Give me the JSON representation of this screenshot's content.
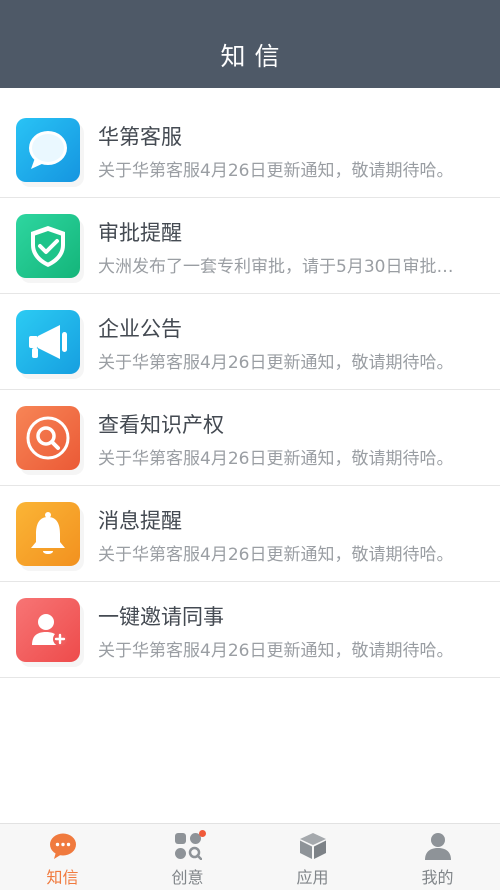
{
  "header": {
    "title": "知信"
  },
  "messages": [
    {
      "title": "华第客服",
      "subtitle": "关于华第客服4月26日更新通知，敬请期待哈。",
      "icon": "chat-bubble-icon",
      "color": "#1aa6e8"
    },
    {
      "title": "审批提醒",
      "subtitle": "大洲发布了一套专利审批，请于5月30日审批…",
      "icon": "shield-check-icon",
      "color": "#22c48a"
    },
    {
      "title": "企业公告",
      "subtitle": "关于华第客服4月26日更新通知，敬请期待哈。",
      "icon": "megaphone-icon",
      "color": "#22b3e6"
    },
    {
      "title": "查看知识产权",
      "subtitle": "关于华第客服4月26日更新通知，敬请期待哈。",
      "icon": "search-icon",
      "color": "#f06c42"
    },
    {
      "title": "消息提醒",
      "subtitle": "关于华第客服4月26日更新通知，敬请期待哈。",
      "icon": "bell-icon",
      "color": "#f5a026"
    },
    {
      "title": "一键邀请同事",
      "subtitle": "关于华第客服4月26日更新通知，敬请期待哈。",
      "icon": "add-user-icon",
      "color": "#f45f5f"
    }
  ],
  "tabs": [
    {
      "label": "知信",
      "icon": "chat-icon",
      "active": true
    },
    {
      "label": "创意",
      "icon": "ideas-icon",
      "active": false,
      "badge": true
    },
    {
      "label": "应用",
      "icon": "box-icon",
      "active": false
    },
    {
      "label": "我的",
      "icon": "user-icon",
      "active": false
    }
  ],
  "colors": {
    "header_bg": "#4e5967",
    "accent": "#f07a3e",
    "tab_inactive": "#808589"
  }
}
